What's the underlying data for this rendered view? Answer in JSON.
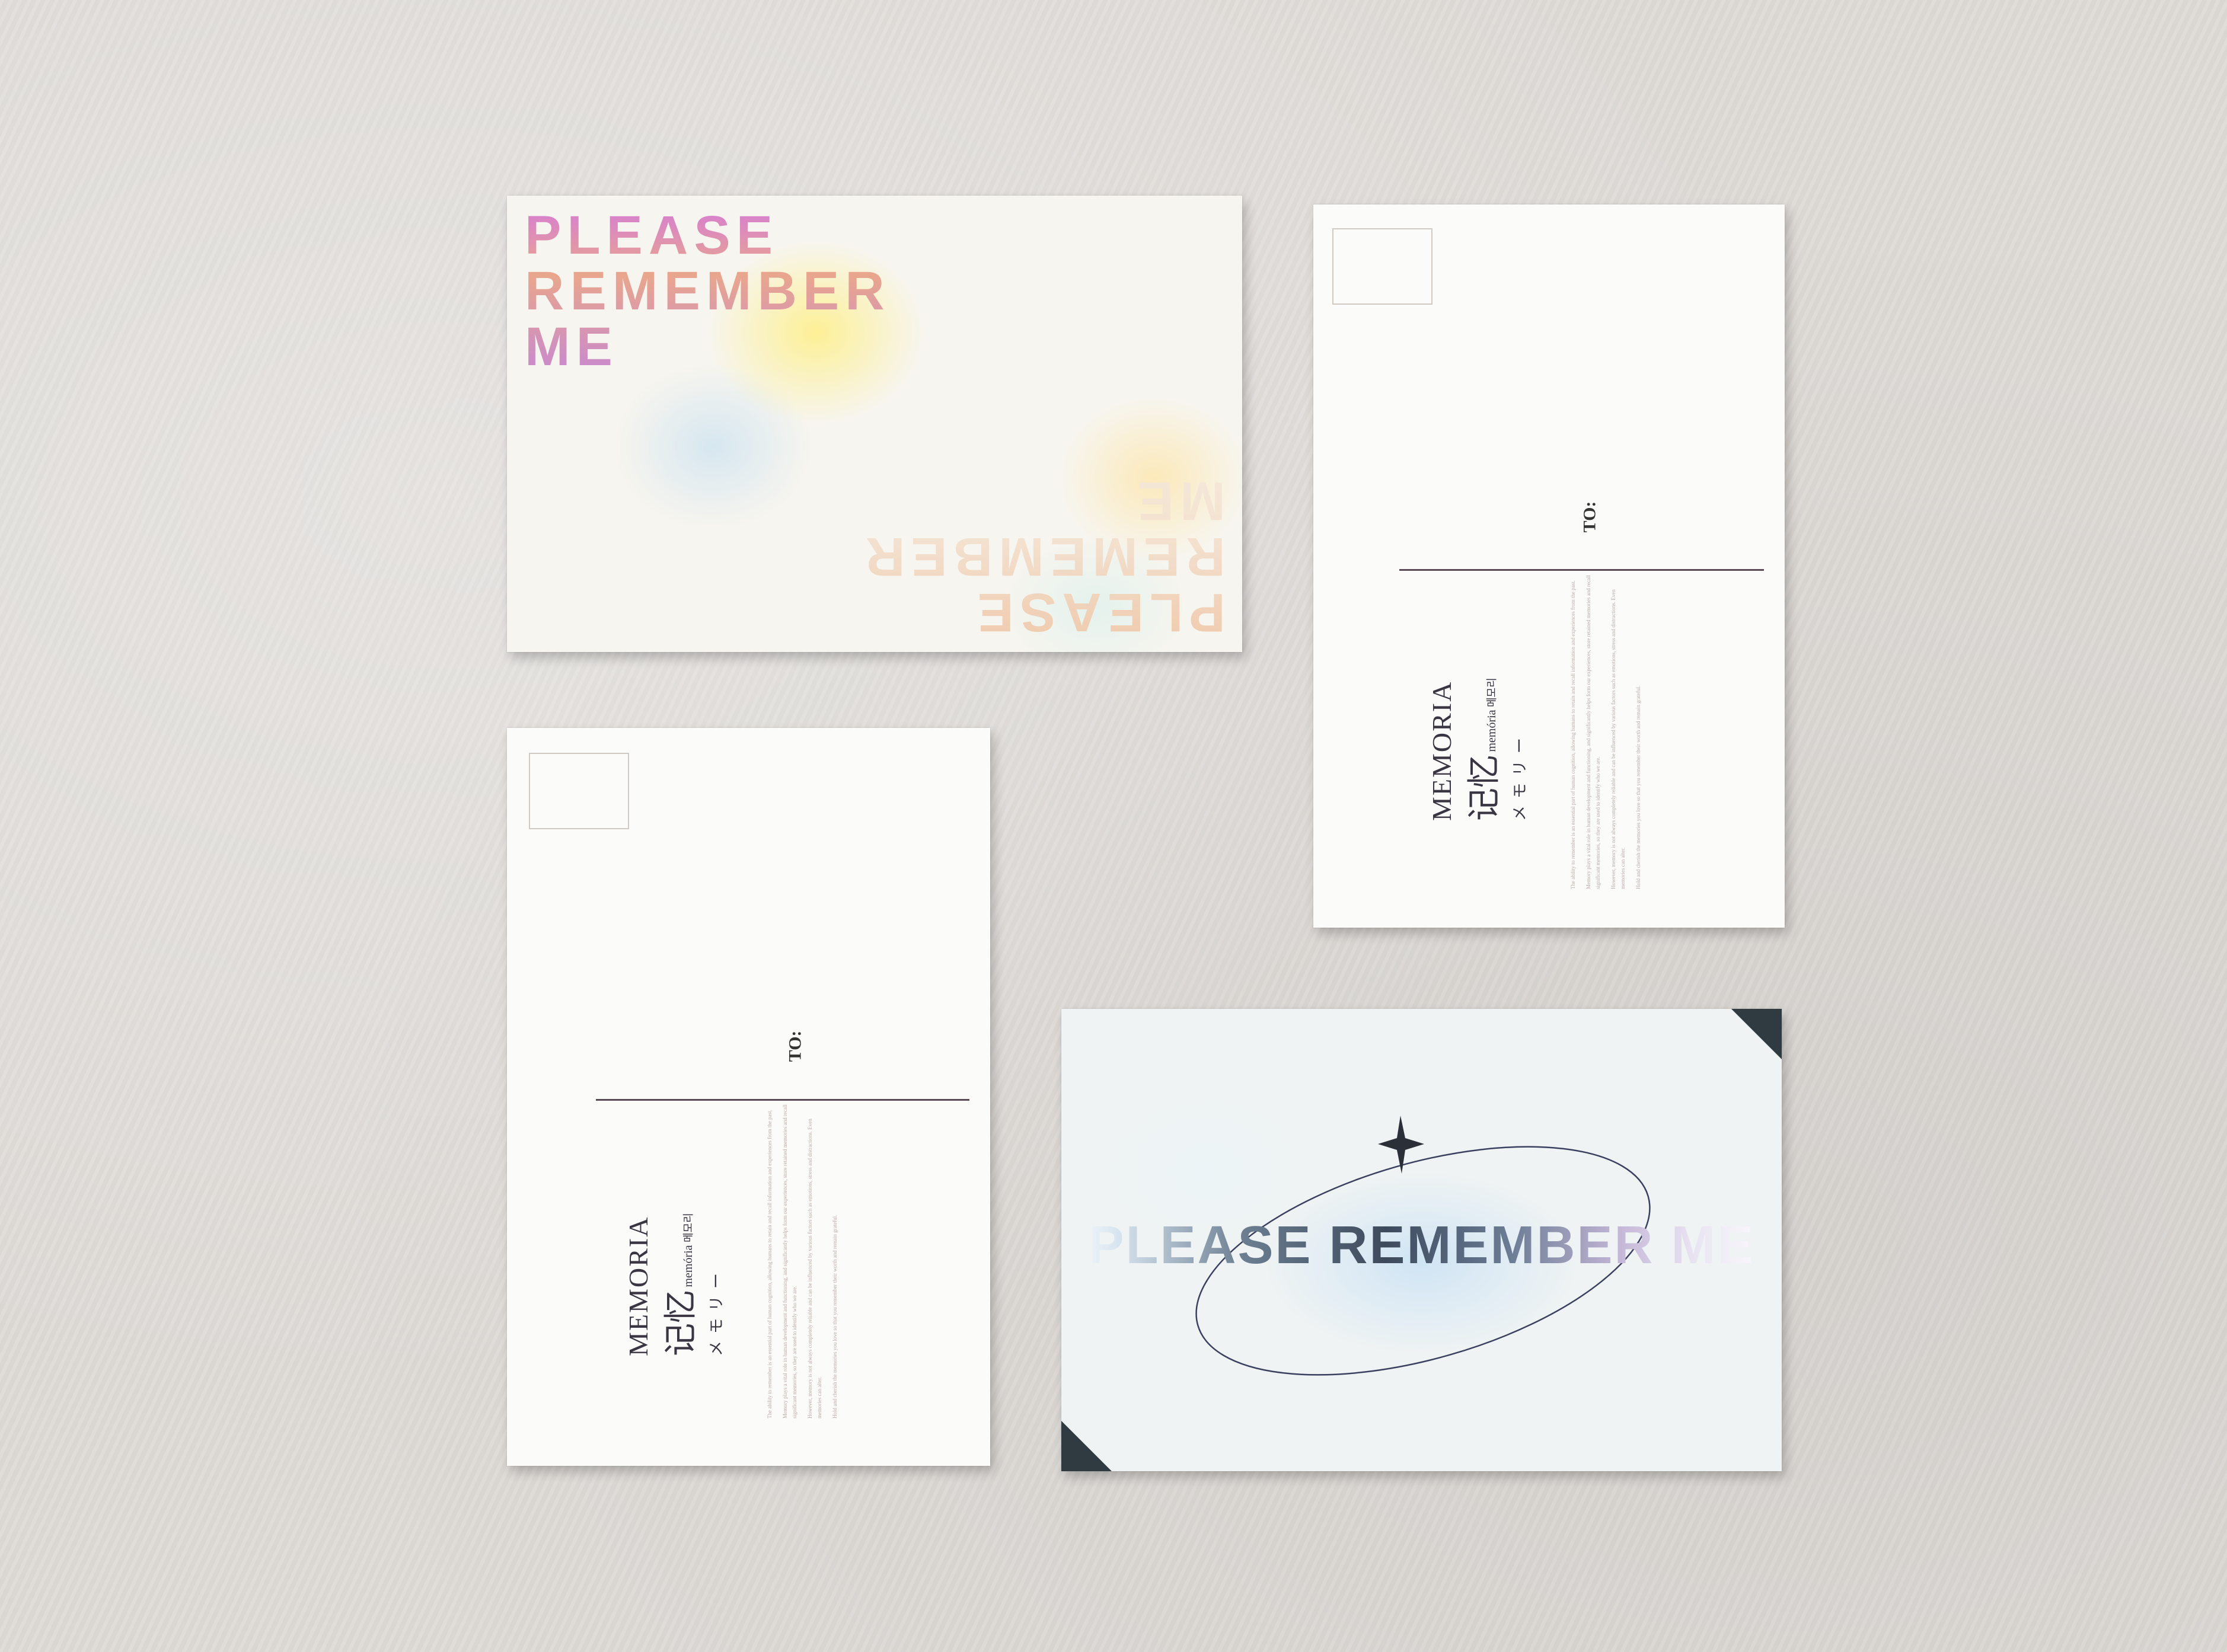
{
  "front_card": {
    "title_lines": [
      "PLEASE",
      "REMEMBER",
      "ME"
    ]
  },
  "postcard_back": {
    "to_label": "TO:",
    "brand": {
      "word": "MEMORIA",
      "cjk": "记忆",
      "small": "memória",
      "hangul": "메모리",
      "kana": "メモリー"
    },
    "paragraphs": [
      "The ability to remember is an essential part of human cognition, allowing humans to retain and recall information and experiences from the past.",
      "Memory plays a vital role in human development and functioning, and significantly helps form our experiences, store retained memories and recall significant memories, so they are used to identify who we are.",
      "However, memory is not always completely reliable and can be influenced by various factors such as emotions, stress and distractions. Even memories can alter.",
      "Hold and cherish the memories you love so that you remember their worth and remain grateful."
    ]
  },
  "holo_card": {
    "title": "PLEASE REMEMBER ME"
  },
  "colors": {
    "corner": "#2f3b40",
    "ink": "#3a3542",
    "line": "#5a4a55",
    "background": "#dedbd7"
  }
}
